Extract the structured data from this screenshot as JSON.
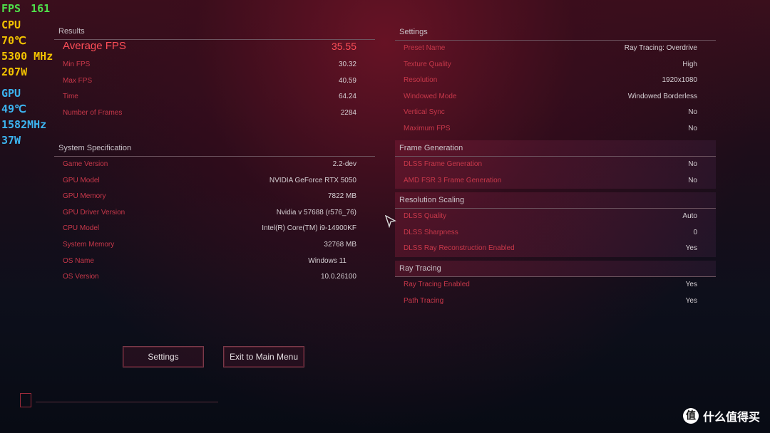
{
  "hud": {
    "fps_label": "FPS",
    "fps_value": "161",
    "cpu": [
      "CPU",
      "70℃",
      "5300 MHz",
      "207W"
    ],
    "gpu": [
      "GPU",
      "49℃",
      "1582MHz",
      "37W"
    ]
  },
  "results": {
    "title": "Results",
    "average": {
      "label": "Average FPS",
      "value": "35.55"
    },
    "rows": [
      {
        "label": "Min FPS",
        "value": "30.32"
      },
      {
        "label": "Max FPS",
        "value": "40.59"
      },
      {
        "label": "Time",
        "value": "64.24"
      },
      {
        "label": "Number of Frames",
        "value": "2284"
      }
    ]
  },
  "system": {
    "title": "System Specification",
    "rows": [
      {
        "label": "Game Version",
        "value": "2.2-dev"
      },
      {
        "label": "GPU Model",
        "value": "NVIDIA GeForce RTX 5050"
      },
      {
        "label": "GPU Memory",
        "value": "7822 MB"
      },
      {
        "label": "GPU Driver Version",
        "value": "Nvidia v 57688 (r576_76)"
      },
      {
        "label": "CPU Model",
        "value": "Intel(R) Core(TM) i9-14900KF"
      },
      {
        "label": "System Memory",
        "value": "32768 MB"
      },
      {
        "label": "OS Name",
        "value": "Windows 11"
      },
      {
        "label": "OS Version",
        "value": "10.0.26100"
      }
    ]
  },
  "settings": {
    "title": "Settings",
    "rows": [
      {
        "label": "Preset Name",
        "value": "Ray Tracing: Overdrive"
      },
      {
        "label": "Texture Quality",
        "value": "High"
      },
      {
        "label": "Resolution",
        "value": "1920x1080"
      },
      {
        "label": "Windowed Mode",
        "value": "Windowed Borderless"
      },
      {
        "label": "Vertical Sync",
        "value": "No"
      },
      {
        "label": "Maximum FPS",
        "value": "No"
      }
    ]
  },
  "frame_generation": {
    "title": "Frame Generation",
    "rows": [
      {
        "label": "DLSS Frame Generation",
        "value": "No"
      },
      {
        "label": "AMD FSR 3 Frame Generation",
        "value": "No"
      }
    ]
  },
  "resolution_scaling": {
    "title": "Resolution Scaling",
    "rows": [
      {
        "label": "DLSS Quality",
        "value": "Auto"
      },
      {
        "label": "DLSS Sharpness",
        "value": "0"
      },
      {
        "label": "DLSS Ray Reconstruction Enabled",
        "value": "Yes"
      }
    ]
  },
  "ray_tracing": {
    "title": "Ray Tracing",
    "rows": [
      {
        "label": "Ray Tracing Enabled",
        "value": "Yes"
      },
      {
        "label": "Path Tracing",
        "value": "Yes"
      }
    ]
  },
  "buttons": {
    "settings": "Settings",
    "exit": "Exit to Main Menu"
  },
  "watermark": {
    "logo": "值",
    "text": "什么值得买"
  }
}
